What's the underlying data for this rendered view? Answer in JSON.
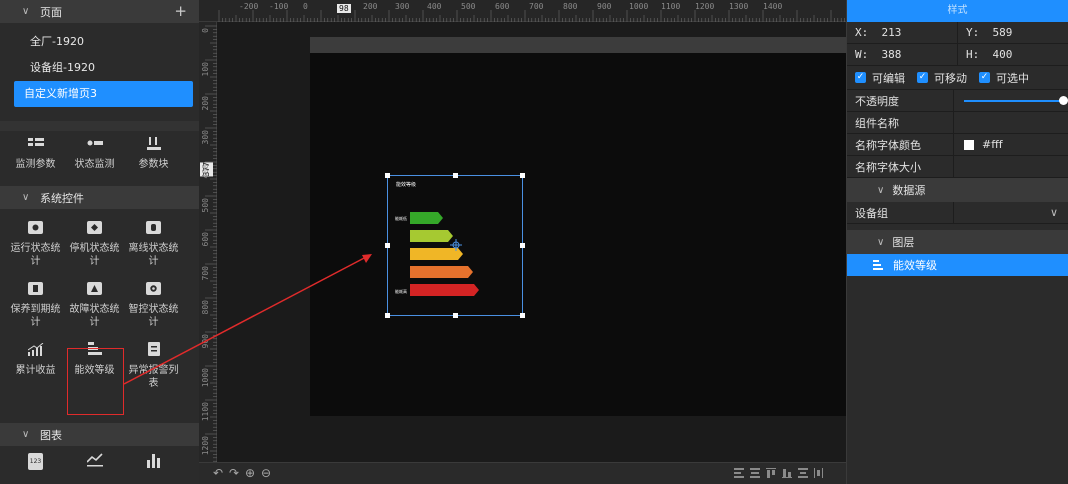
{
  "left_panel": {
    "pages_header": {
      "label": "页面",
      "add_icon": "plus-icon"
    },
    "pages": [
      {
        "label": "全厂-1920",
        "active": false
      },
      {
        "label": "设备组-1920",
        "active": false
      },
      {
        "label": "自定义新增页3",
        "active": true
      }
    ],
    "top_widgets": [
      {
        "label": "监测参数",
        "icon": "monitor-params-icon"
      },
      {
        "label": "状态监测",
        "icon": "status-monitor-icon"
      },
      {
        "label": "参数块",
        "icon": "param-block-icon"
      }
    ],
    "system_controls_header": "系统控件",
    "system_widgets": [
      {
        "label": "运行状态统计",
        "icon": "run-status-icon"
      },
      {
        "label": "停机状态统计",
        "icon": "stop-status-icon"
      },
      {
        "label": "离线状态统计",
        "icon": "offline-status-icon"
      },
      {
        "label": "保养到期统计",
        "icon": "maintenance-icon"
      },
      {
        "label": "故障状态统计",
        "icon": "fault-status-icon"
      },
      {
        "label": "智控状态统计",
        "icon": "smart-control-icon"
      },
      {
        "label": "累计收益",
        "icon": "cumulative-income-icon"
      },
      {
        "label": "能效等级",
        "icon": "energy-level-icon"
      },
      {
        "label": "异常报警列表",
        "icon": "alarm-list-icon"
      }
    ],
    "charts_header": "图表",
    "chart_widgets": [
      {
        "icon": "number-card-icon",
        "text": "123"
      },
      {
        "icon": "line-chart-icon"
      },
      {
        "icon": "bar-chart-icon"
      }
    ]
  },
  "canvas": {
    "ruler_top_labels": [
      "-200",
      "-100",
      "0",
      "98",
      "200",
      "300",
      "400",
      "500",
      "600",
      "700",
      "800",
      "900",
      "1000",
      "1100",
      "1200",
      "1300",
      "1400"
    ],
    "ruler_top_badge": "98",
    "ruler_left_labels": [
      "0",
      "100",
      "200",
      "300",
      "400",
      "500",
      "600",
      "700",
      "800",
      "900",
      "1000",
      "1100",
      "1200"
    ],
    "ruler_left_badge": "377",
    "component": {
      "title": "能效等级",
      "top_label": "能耗低",
      "bottom_label": "能耗高",
      "levels": [
        {
          "color": "#35a829"
        },
        {
          "color": "#a6c931"
        },
        {
          "color": "#f0b626"
        },
        {
          "color": "#e6722d"
        },
        {
          "color": "#d42424"
        }
      ]
    },
    "annotation_arrow_color": "#e02b2b"
  },
  "right_panel": {
    "header": "样式",
    "x_label": "X:",
    "x_value": "213",
    "y_label": "Y:",
    "y_value": "589",
    "w_label": "W:",
    "w_value": "388",
    "h_label": "H:",
    "h_value": "400",
    "checks": [
      {
        "label": "可编辑",
        "checked": true
      },
      {
        "label": "可移动",
        "checked": true
      },
      {
        "label": "可选中",
        "checked": true
      }
    ],
    "opacity_label": "不透明度",
    "opacity": 1.0,
    "name_label": "组件名称",
    "name_color_label": "名称字体颜色",
    "name_color_value": "#fff",
    "name_size_label": "名称字体大小",
    "datasource_header": "数据源",
    "device_group_label": "设备组",
    "layers_header": "图层",
    "layer_item": "能效等级",
    "accent": "#1f8fff"
  }
}
